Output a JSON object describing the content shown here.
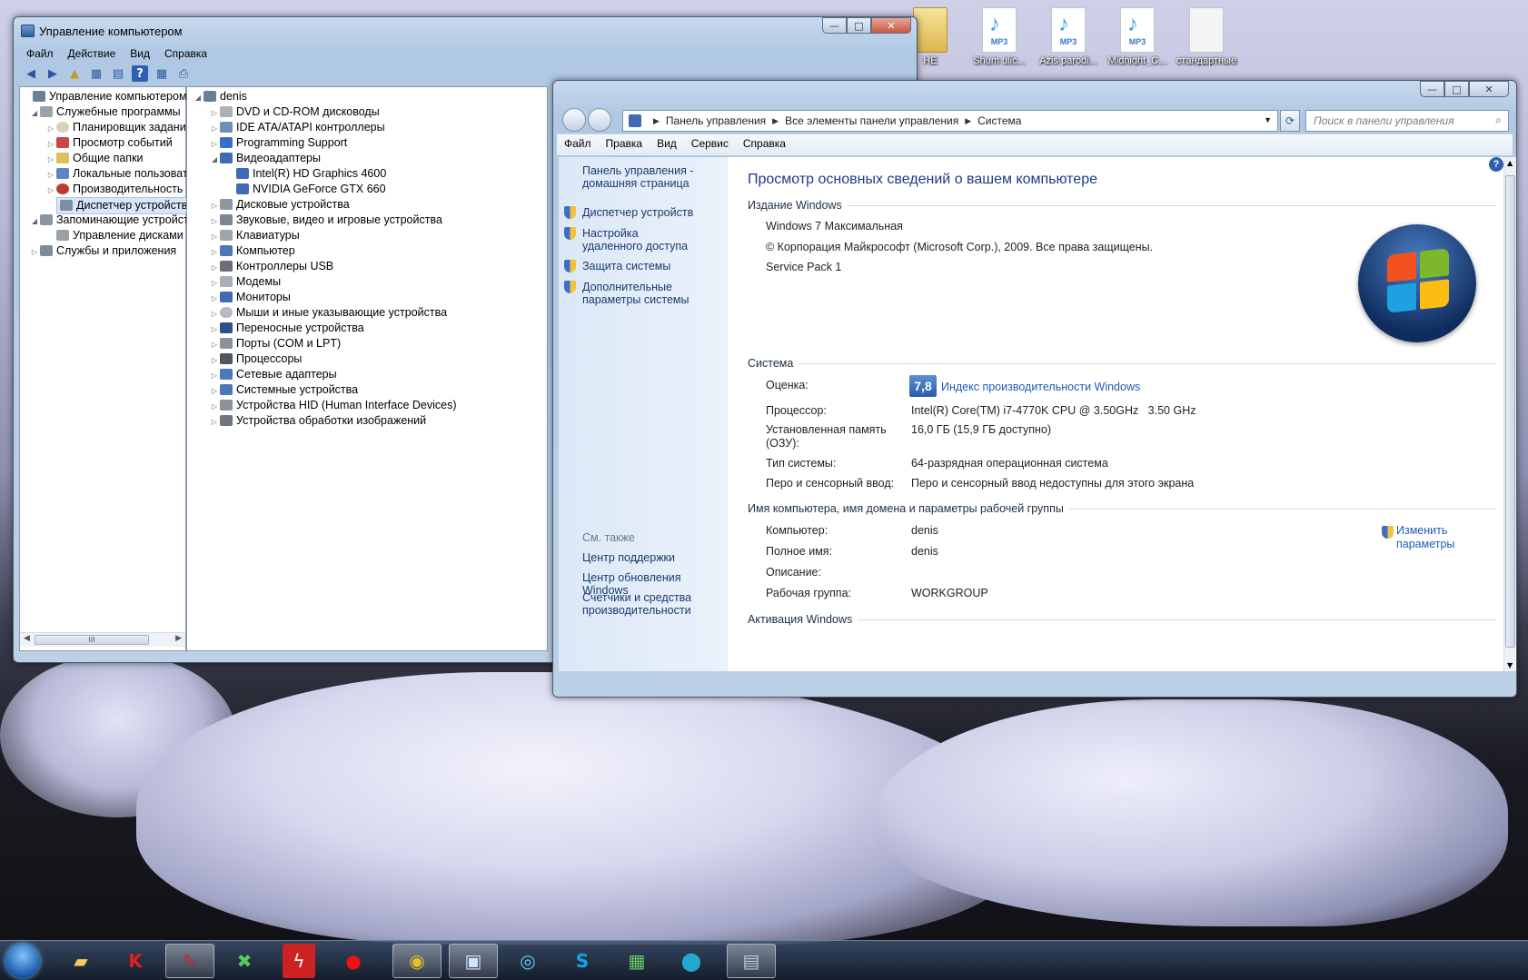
{
  "desktop": {
    "icons": [
      {
        "label": "НЕ",
        "kind": "folder"
      },
      {
        "label": "Shum ulic...",
        "kind": "mp3",
        "badge": "MP3"
      },
      {
        "label": "Azis parodi...",
        "kind": "mp3",
        "badge": "MP3"
      },
      {
        "label": "Midnight_C...",
        "kind": "mp3",
        "badge": "MP3"
      },
      {
        "label": "стандартные",
        "kind": "doc"
      }
    ]
  },
  "cm_window": {
    "title": "Управление компьютером",
    "menu": [
      "Файл",
      "Действие",
      "Вид",
      "Справка"
    ],
    "left_tree": [
      {
        "label": "Управление компьютером (л",
        "level": 0,
        "twisty": ""
      },
      {
        "label": "Служебные программы",
        "level": 1,
        "twisty": "◢"
      },
      {
        "label": "Планировщик заданий",
        "level": 2,
        "twisty": "▷"
      },
      {
        "label": "Просмотр событий",
        "level": 2,
        "twisty": "▷"
      },
      {
        "label": "Общие папки",
        "level": 2,
        "twisty": "▷"
      },
      {
        "label": "Локальные пользовате",
        "level": 2,
        "twisty": "▷"
      },
      {
        "label": "Производительность",
        "level": 2,
        "twisty": "▷"
      },
      {
        "label": "Диспетчер устройств",
        "level": 2,
        "twisty": "",
        "selected": true
      },
      {
        "label": "Запоминающие устройст",
        "level": 1,
        "twisty": "◢"
      },
      {
        "label": "Управление дисками",
        "level": 2,
        "twisty": ""
      },
      {
        "label": "Службы и приложения",
        "level": 1,
        "twisty": "▷"
      }
    ],
    "scroll_grip": "III",
    "device_tree": [
      {
        "label": "denis",
        "level": 0,
        "twisty": "◢"
      },
      {
        "label": "DVD и CD-ROM дисководы",
        "level": 1,
        "twisty": "▷"
      },
      {
        "label": "IDE ATA/ATAPI контроллеры",
        "level": 1,
        "twisty": "▷"
      },
      {
        "label": "Programming Support",
        "level": 1,
        "twisty": "▷"
      },
      {
        "label": "Видеоадаптеры",
        "level": 1,
        "twisty": "◢"
      },
      {
        "label": "Intel(R) HD Graphics 4600",
        "level": 2,
        "twisty": ""
      },
      {
        "label": "NVIDIA GeForce GTX 660",
        "level": 2,
        "twisty": ""
      },
      {
        "label": "Дисковые устройства",
        "level": 1,
        "twisty": "▷"
      },
      {
        "label": "Звуковые, видео и игровые устройства",
        "level": 1,
        "twisty": "▷"
      },
      {
        "label": "Клавиатуры",
        "level": 1,
        "twisty": "▷"
      },
      {
        "label": "Компьютер",
        "level": 1,
        "twisty": "▷"
      },
      {
        "label": "Контроллеры USB",
        "level": 1,
        "twisty": "▷"
      },
      {
        "label": "Модемы",
        "level": 1,
        "twisty": "▷"
      },
      {
        "label": "Мониторы",
        "level": 1,
        "twisty": "▷"
      },
      {
        "label": "Мыши и иные указывающие устройства",
        "level": 1,
        "twisty": "▷"
      },
      {
        "label": "Переносные устройства",
        "level": 1,
        "twisty": "▷"
      },
      {
        "label": "Порты (COM и LPT)",
        "level": 1,
        "twisty": "▷"
      },
      {
        "label": "Процессоры",
        "level": 1,
        "twisty": "▷"
      },
      {
        "label": "Сетевые адаптеры",
        "level": 1,
        "twisty": "▷"
      },
      {
        "label": "Системные устройства",
        "level": 1,
        "twisty": "▷"
      },
      {
        "label": "Устройства HID (Human Interface Devices)",
        "level": 1,
        "twisty": "▷"
      },
      {
        "label": "Устройства обработки изображений",
        "level": 1,
        "twisty": "▷"
      }
    ]
  },
  "sys_window": {
    "breadcrumb": [
      "Панель управления",
      "Все элементы панели управления",
      "Система"
    ],
    "search_placeholder": "Поиск в панели управления",
    "menu": [
      "Файл",
      "Правка",
      "Вид",
      "Сервис",
      "Справка"
    ],
    "left_links": [
      "Панель управления - домашняя страница",
      "Диспетчер устройств",
      "Настройка удаленного доступа",
      "Защита системы",
      "Дополнительные параметры системы"
    ],
    "see_also_title": "См. также",
    "see_also": [
      "Центр поддержки",
      "Центр обновления Windows",
      "Счетчики и средства производительности"
    ],
    "heading": "Просмотр основных сведений о вашем компьютере",
    "edition_title": "Издание Windows",
    "edition": "Windows 7 Максимальная",
    "copyright": "© Корпорация Майкрософт (Microsoft Corp.), 2009. Все права защищены.",
    "service_pack": "Service Pack 1",
    "system_title": "Система",
    "rating_label": "Оценка:",
    "rating_value": "7,8",
    "rating_link": "Индекс производительности Windows",
    "processor_label": "Процессор:",
    "processor_value": "Intel(R) Core(TM) i7-4770K CPU @ 3.50GHz   3.50 GHz",
    "memory_label": "Установленная память (ОЗУ):",
    "memory_value": "16,0 ГБ (15,9 ГБ доступно)",
    "type_label": "Тип системы:",
    "type_value": "64-разрядная операционная система",
    "pen_label": "Перо и сенсорный ввод:",
    "pen_value": "Перо и сенсорный ввод недоступны для этого экрана",
    "computer_section_title": "Имя компьютера, имя домена и параметры рабочей группы",
    "computer_label": "Компьютер:",
    "computer_value": "denis",
    "fullname_label": "Полное имя:",
    "fullname_value": "denis",
    "description_label": "Описание:",
    "workgroup_label": "Рабочая группа:",
    "workgroup_value": "WORKGROUP",
    "change_link": "Изменить параметры",
    "activation_title": "Активация Windows"
  },
  "taskbar": {
    "buttons": [
      "explorer",
      "kaspersky",
      "paint",
      "xbox",
      "flash",
      "record",
      "chrome",
      "computer-management",
      "steam",
      "skype",
      "network",
      "ball",
      "control-panel"
    ]
  }
}
